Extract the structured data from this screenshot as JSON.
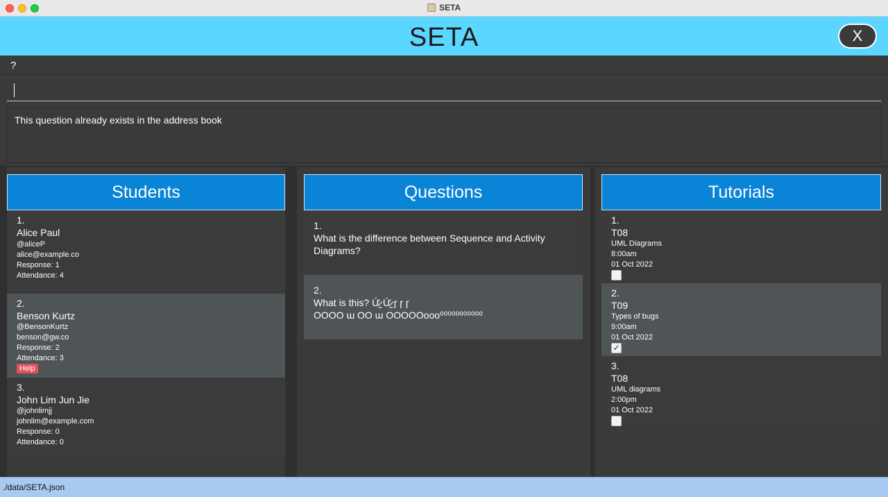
{
  "window": {
    "title": "SETA"
  },
  "header": {
    "title": "SETA",
    "exit_label": "X"
  },
  "menu": {
    "help_label": "?"
  },
  "command": {
    "value": "",
    "placeholder": ""
  },
  "result": {
    "message": "This question already exists in the address book"
  },
  "students": {
    "heading": "Students",
    "items": [
      {
        "index": "1.",
        "name": "Alice Paul",
        "handle": "@aliceP",
        "email": "alice@example.co",
        "response": "Response: 1",
        "attendance": "Attendance: 4"
      },
      {
        "index": "2.",
        "name": "Benson Kurtz",
        "handle": "@BensonKurtz",
        "email": "benson@gw.co",
        "response": "Response: 2",
        "attendance": "Attendance: 3",
        "tag": "Help"
      },
      {
        "index": "3.",
        "name": "John Lim Jun Jie",
        "handle": "@johnlimjj",
        "email": "johnlim@example.com",
        "response": "Response: 0",
        "attendance": "Attendance: 0"
      }
    ]
  },
  "questions": {
    "heading": "Questions",
    "items": [
      {
        "index": "1.",
        "line1": "What is the difference between Sequence and Activity",
        "line2": "Diagrams?"
      },
      {
        "index": "2.",
        "line1": "What is this? Ứ̷̰ Ứ̷̰ ɼ ɼ ɼ",
        "line2": "OOOO ɯ OO ɯ OOOOOooo⁰⁰⁰⁰⁰⁰⁰⁰⁰⁰⁰"
      }
    ]
  },
  "tutorials": {
    "heading": "Tutorials",
    "items": [
      {
        "index": "1.",
        "group": "T08",
        "topic": "UML Diagrams",
        "time": "8:00am",
        "date": "01 Oct 2022",
        "done": false
      },
      {
        "index": "2.",
        "group": "T09",
        "topic": "Types of bugs",
        "time": "9:00am",
        "date": "01 Oct 2022",
        "done": true
      },
      {
        "index": "3.",
        "group": "T08",
        "topic": "UML diagrams",
        "time": "2:00pm",
        "date": "01 Oct 2022",
        "done": false
      }
    ]
  },
  "status": {
    "file_path": "./data/SETA.json"
  },
  "colors": {
    "header": "#5bd6ff",
    "panel_heading": "#0a84d6",
    "selected_row": "#4f5457",
    "tag": "#e3515b",
    "status_bar": "#a8c9f0"
  }
}
